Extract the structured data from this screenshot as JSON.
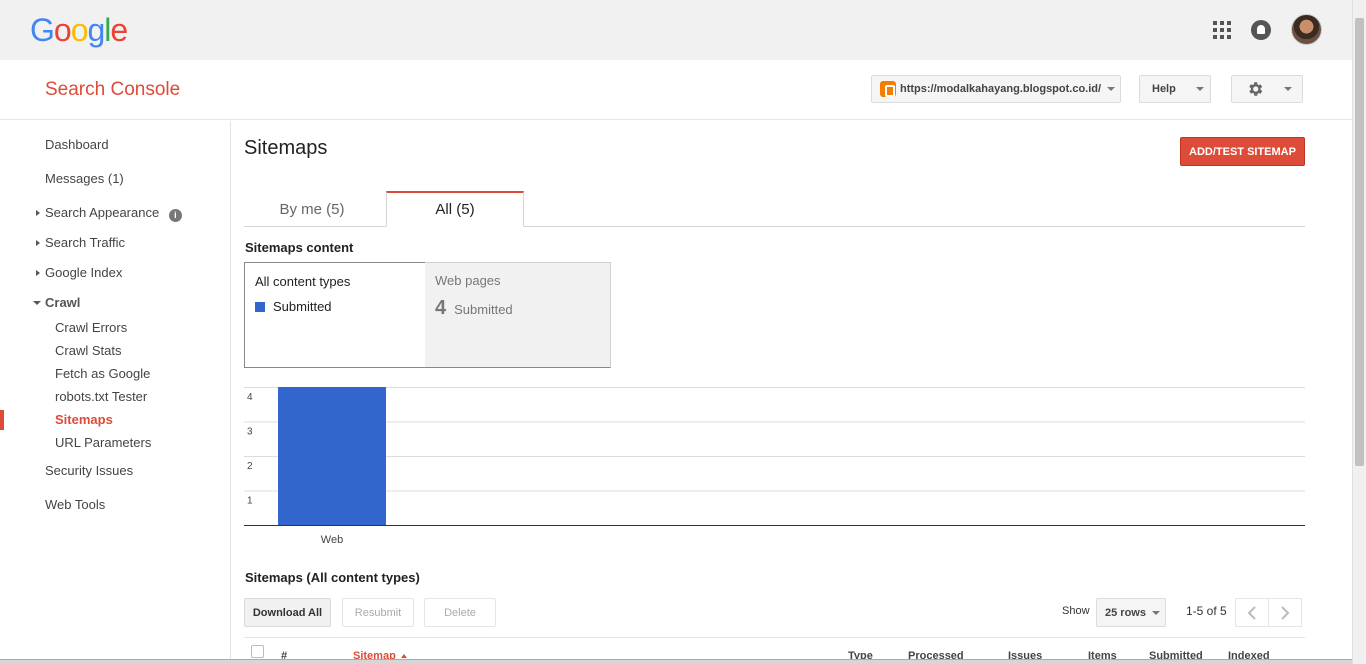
{
  "topbar": {
    "logo_letters": [
      {
        "ch": "G",
        "color": "#4285f4"
      },
      {
        "ch": "o",
        "color": "#ea4335"
      },
      {
        "ch": "o",
        "color": "#fbbc05"
      },
      {
        "ch": "g",
        "color": "#4285f4"
      },
      {
        "ch": "l",
        "color": "#34a853"
      },
      {
        "ch": "e",
        "color": "#ea4335"
      }
    ],
    "icons": [
      "apps-icon",
      "notifications-icon",
      "account-avatar"
    ]
  },
  "header": {
    "product_title": "Search Console",
    "site_url": "https://modalkahayang.blogspot.co.id/",
    "help_label": "Help",
    "settings_icon": "gear-icon",
    "brand_color": "#dd4b39"
  },
  "sidebar": {
    "dashboard": "Dashboard",
    "messages": "Messages (1)",
    "search_appearance": "Search Appearance",
    "search_traffic": "Search Traffic",
    "google_index": "Google Index",
    "crawl": "Crawl",
    "crawl_items": [
      "Crawl Errors",
      "Crawl Stats",
      "Fetch as Google",
      "robots.txt Tester",
      "Sitemaps",
      "URL Parameters"
    ],
    "active_item": "Sitemaps",
    "security_issues": "Security Issues",
    "web_tools": "Web Tools"
  },
  "main": {
    "page_title": "Sitemaps",
    "add_button": "ADD/TEST SITEMAP",
    "tabs": [
      {
        "label": "By me (5)",
        "selected": false
      },
      {
        "label": "All (5)",
        "selected": true
      }
    ],
    "content_section_label": "Sitemaps content",
    "content_types": {
      "all_label": "All content types",
      "legend_label": "Submitted",
      "web_label": "Web pages",
      "web_value": "4",
      "web_value_label": "Submitted"
    },
    "table_section_label": "Sitemaps (All content types)",
    "actions": {
      "download_all": "Download All",
      "resubmit": "Resubmit",
      "delete": "Delete"
    },
    "pagination": {
      "show_label": "Show",
      "rows_value": "25 rows",
      "range": "1-5 of 5"
    },
    "table_headers": {
      "num": "#",
      "sitemap": "Sitemap",
      "type": "Type",
      "processed": "Processed",
      "issues": "Issues",
      "items": "Items",
      "submitted": "Submitted",
      "indexed": "Indexed"
    }
  },
  "chart_data": {
    "type": "bar",
    "categories": [
      "Web"
    ],
    "series": [
      {
        "name": "Submitted",
        "values": [
          4
        ],
        "color": "#3366cc"
      }
    ],
    "yticks": [
      1,
      2,
      3,
      4
    ],
    "ylim": [
      0,
      4
    ],
    "grid": true
  }
}
